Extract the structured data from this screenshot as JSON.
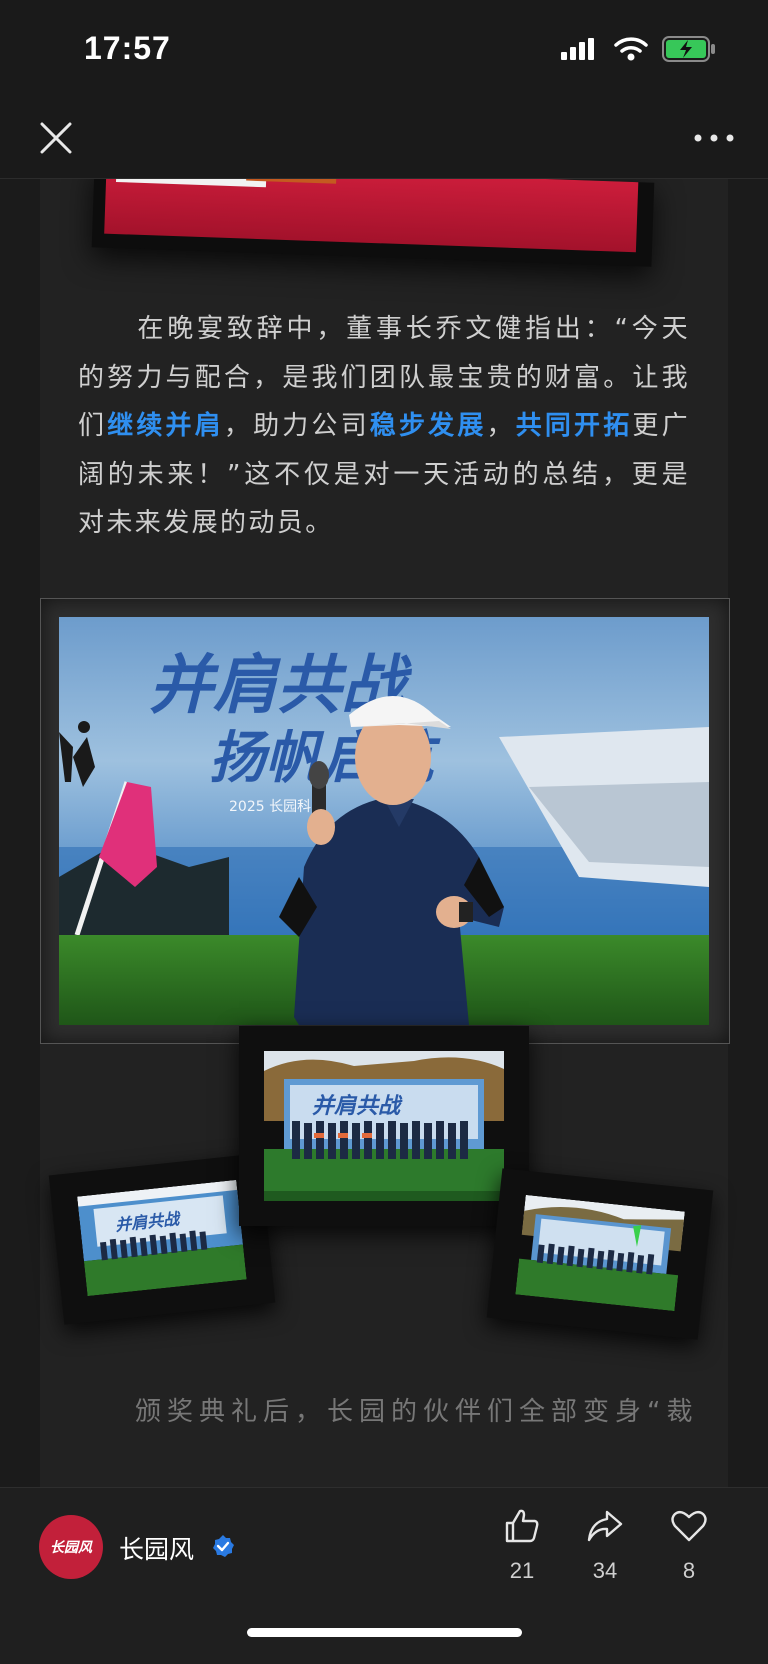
{
  "status_bar": {
    "time": "17:57"
  },
  "nav": {
    "close_icon": "close-icon",
    "more_icon": "more-dots-icon"
  },
  "article": {
    "p1_a": "在晚宴致辞中，董事长乔文健指出：“今天的努力与配合，是我们团队最宝贵的财富。让我们",
    "p1_hl1": "继续并肩",
    "p1_b": "，助力公司",
    "p1_hl2": "稳步发展",
    "p1_c": "，",
    "p1_hl3": "共同开拓",
    "p1_d": "更广阔的未来！”这不仅是对一天活动的总结，更是对未来发展的动员。",
    "banner_title_1": "并肩共战",
    "banner_title_2": "扬帆启航",
    "banner_sub": "2025 长园科",
    "next_para_partial": "颁奖典礼后，长园的伙伴们全部变身“裁"
  },
  "account": {
    "avatar_text": "长园风",
    "name": "长园风"
  },
  "actions": {
    "like_count": "21",
    "share_count": "34",
    "favorite_count": "8"
  },
  "colors": {
    "highlight": "#2f8ff0",
    "avatar_bg": "#c2203a",
    "verified": "#2a7ae2"
  }
}
